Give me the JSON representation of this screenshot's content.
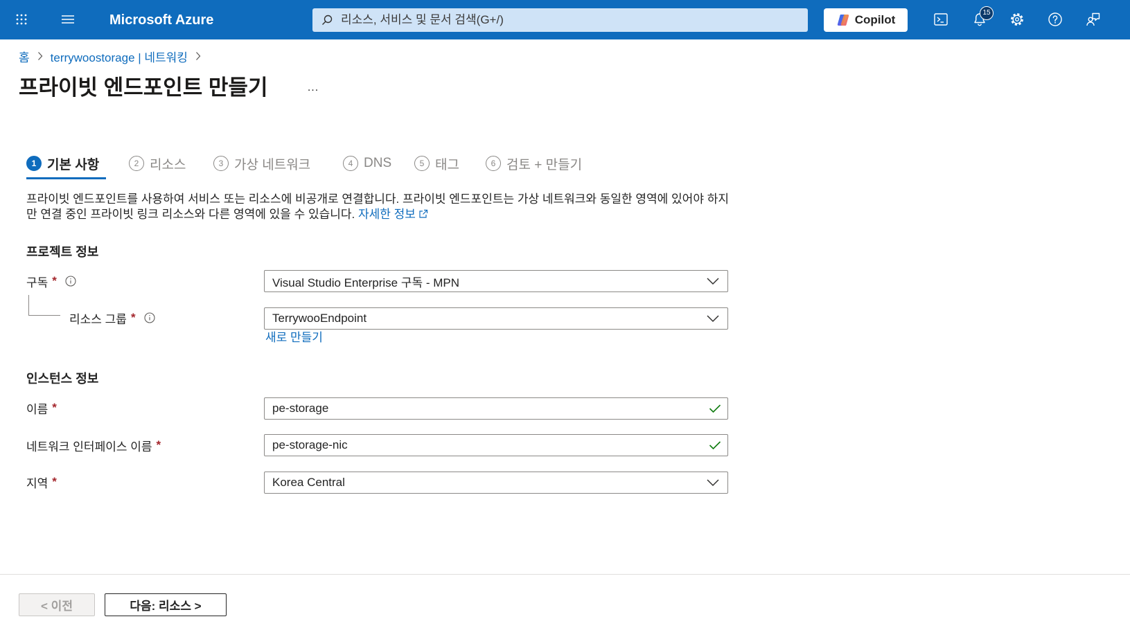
{
  "colors": {
    "header": "#0f6cbd",
    "accent": "#0f6cbd",
    "link": "#0f6cbd",
    "required": "#a4262c",
    "valid": "#107c10",
    "text": "#242424",
    "muted": "#8a8886"
  },
  "topbar": {
    "waffle_icon": "waffle-icon",
    "menu_icon": "hamburger-menu-icon",
    "brand": "Microsoft Azure",
    "search": {
      "icon": "search-icon",
      "placeholder": "리소스, 서비스 및 문서 검색(G+/)"
    },
    "copilot": {
      "icon": "copilot-icon",
      "label": "Copilot"
    },
    "actions": [
      {
        "icon": "cloud-shell-icon"
      },
      {
        "icon": "notifications-icon",
        "badge": "15"
      },
      {
        "icon": "settings-icon"
      },
      {
        "icon": "help-icon"
      },
      {
        "icon": "feedback-icon"
      }
    ]
  },
  "breadcrumb": {
    "separator_icon": "chevron-right-icon",
    "items": [
      {
        "label": "홈"
      },
      {
        "label": "terrywoostorage | 네트워킹"
      }
    ]
  },
  "page": {
    "title": "프라이빗 엔드포인트 만들기",
    "more_label": "..."
  },
  "tabs": [
    {
      "step": "1",
      "label": "기본 사항",
      "active": true
    },
    {
      "step": "2",
      "label": "리소스",
      "active": false
    },
    {
      "step": "3",
      "label": "가상 네트워크",
      "active": false
    },
    {
      "step": "4",
      "label": "DNS",
      "active": false
    },
    {
      "step": "5",
      "label": "태그",
      "active": false
    },
    {
      "step": "6",
      "label": "검토 + 만들기",
      "active": false
    }
  ],
  "intro": {
    "text": "프라이빗 엔드포인트를 사용하여 서비스 또는 리소스에 비공개로 연결합니다. 프라이빗 엔드포인트는 가상 네트워크와 동일한 영역에 있어야 하지만 연결 중인 프라이빗 링크 리소스와 다른 영역에 있을 수 있습니다.",
    "learn_more": "자세한 정보",
    "learn_more_icon": "external-link-icon"
  },
  "form": {
    "required_mark": "*",
    "project_section": "프로젝트 정보",
    "instance_section": "인스턴스 정보",
    "subscription": {
      "label": "구독",
      "value": "Visual Studio Enterprise 구독 - MPN"
    },
    "resource_group": {
      "label": "리소스 그룹",
      "value": "TerrywooEndpoint",
      "create_new": "새로 만들기"
    },
    "name": {
      "label": "이름",
      "value": "pe-storage",
      "valid": true
    },
    "nic_name": {
      "label": "네트워크 인터페이스 이름",
      "value": "pe-storage-nic",
      "valid": true
    },
    "region": {
      "label": "지역",
      "value": "Korea Central"
    }
  },
  "footer": {
    "previous": "< 이전",
    "previous_disabled": true,
    "next": "다음: 리소스 >"
  }
}
